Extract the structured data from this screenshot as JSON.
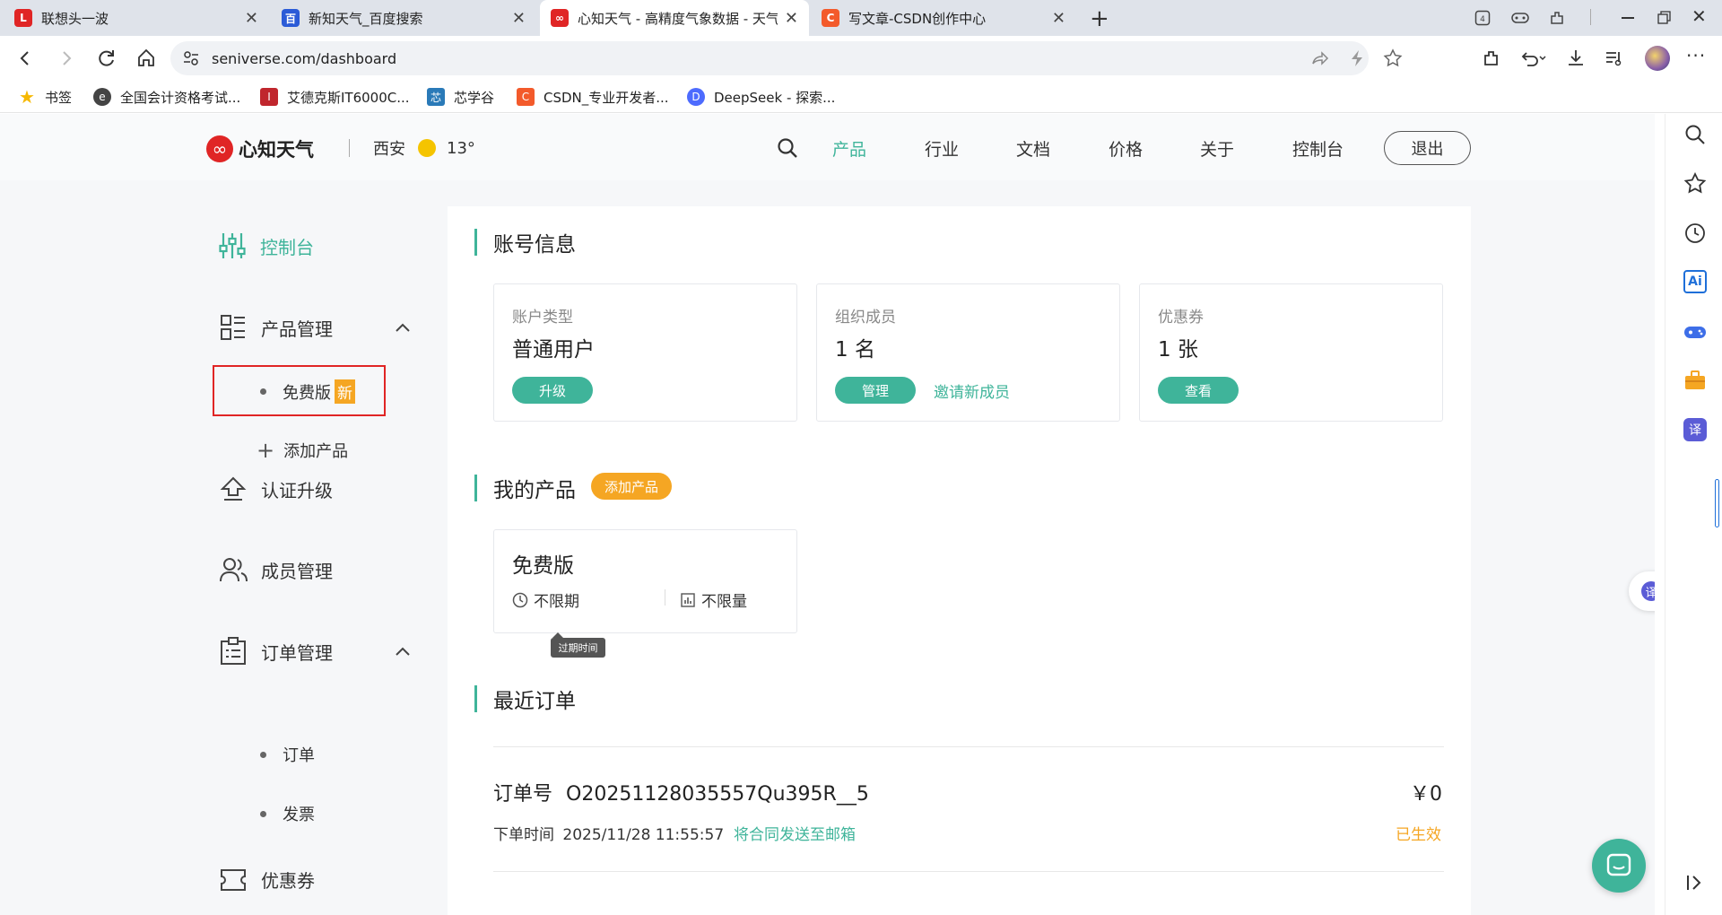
{
  "tabs": [
    {
      "title": "联想头一波",
      "fav": "L",
      "color": "#e02525"
    },
    {
      "title": "新知天气_百度搜索",
      "fav": "百",
      "color": "#2b5bd7"
    },
    {
      "title": "心知天气 - 高精度气象数据 - 天气",
      "fav": "∞",
      "color": "#e02525"
    },
    {
      "title": "写文章-CSDN创作中心",
      "fav": "C",
      "color": "#f35a2b"
    }
  ],
  "address": {
    "url": "seniverse.com/dashboard"
  },
  "bookmarks": [
    {
      "label": "书签"
    },
    {
      "label": "全国会计资格考试..."
    },
    {
      "label": "艾德克斯IT6000C..."
    },
    {
      "label": "芯学谷"
    },
    {
      "label": "CSDN_专业开发者..."
    },
    {
      "label": "DeepSeek - 探索..."
    }
  ],
  "header": {
    "brand": "心知天气",
    "city": "西安",
    "temp": "13°",
    "nav": [
      "产品",
      "行业",
      "文档",
      "价格",
      "关于",
      "控制台"
    ],
    "logout": "退出"
  },
  "sidebar": {
    "dashboard": "控制台",
    "product_mgmt": "产品管理",
    "free_edition": "免费版",
    "new_badge": "新",
    "add_product": "添加产品",
    "cert_upgrade": "认证升级",
    "member_mgmt": "成员管理",
    "order_mgmt": "订单管理",
    "orders": "订单",
    "invoice": "发票",
    "coupons": "优惠券"
  },
  "account": {
    "title": "账号信息",
    "type_label": "账户类型",
    "type_value": "普通用户",
    "upgrade": "升级",
    "members_label": "组织成员",
    "members_value": "1 名",
    "manage": "管理",
    "invite": "邀请新成员",
    "coupon_label": "优惠券",
    "coupon_value": "1 张",
    "view": "查看"
  },
  "products": {
    "title": "我的产品",
    "add": "添加产品",
    "name": "免费版",
    "period": "不限期",
    "quota": "不限量",
    "tooltip": "过期时间"
  },
  "orders": {
    "title": "最近订单",
    "order_label": "订单号",
    "order_no": "O20251128035557Qu395R__5",
    "amount": "￥0",
    "time_label": "下单时间",
    "time": "2025/11/28 11:55:57",
    "send_contract": "将合同发送至邮箱",
    "status": "已生效"
  },
  "colors": {
    "accent": "#3fb49a",
    "orange": "#f5a623",
    "brand": "#e02525"
  }
}
